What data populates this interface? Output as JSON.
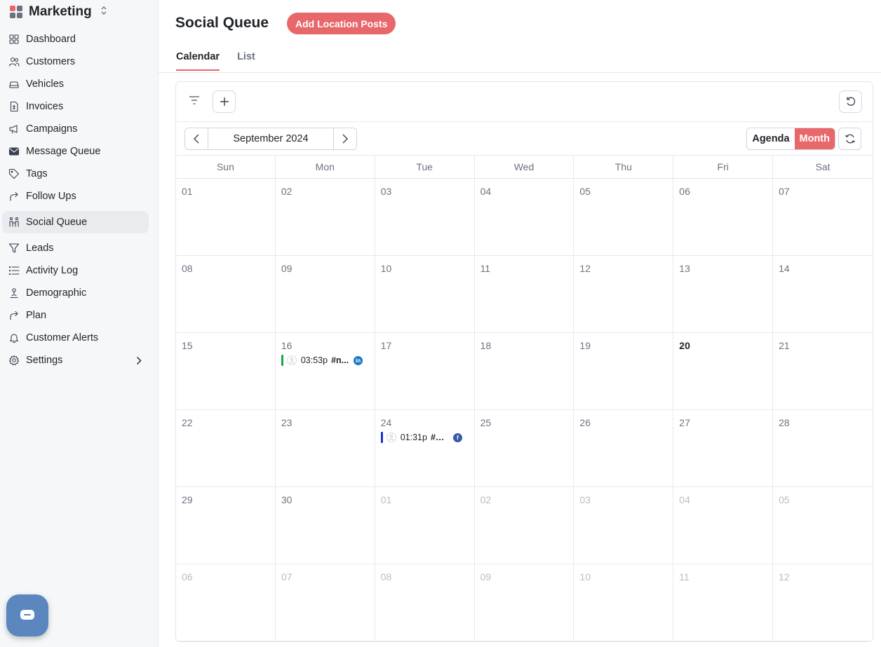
{
  "colors": {
    "accent": "#e8676b",
    "linkedin": "#1a78c2",
    "facebook": "#3b5aa8",
    "event_green": "#1aa548",
    "event_blue": "#1d2ed8",
    "logo": [
      "#e8676b",
      "#6b7280",
      "#6b7280",
      "#6b7280"
    ]
  },
  "brand": {
    "title": "Marketing",
    "switch_icon": "chevron-up-down-icon"
  },
  "sidebar": {
    "items": [
      {
        "label": "Dashboard",
        "icon": "dashboard-icon"
      },
      {
        "label": "Customers",
        "icon": "users-icon"
      },
      {
        "label": "Vehicles",
        "icon": "car-icon"
      },
      {
        "label": "Invoices",
        "icon": "invoice-icon"
      },
      {
        "label": "Campaigns",
        "icon": "megaphone-icon"
      },
      {
        "label": "Message Queue",
        "icon": "envelope-icon"
      },
      {
        "label": "Tags",
        "icon": "tag-icon"
      },
      {
        "label": "Follow Ups",
        "icon": "share-arrow-icon"
      },
      {
        "label": "Social Queue",
        "icon": "people-icon",
        "active": true
      },
      {
        "label": "Leads",
        "icon": "filter-icon"
      },
      {
        "label": "Activity Log",
        "icon": "list-icon"
      },
      {
        "label": "Demographic",
        "icon": "person-pin-icon"
      },
      {
        "label": "Plan",
        "icon": "share-arrow-icon"
      },
      {
        "label": "Customer Alerts",
        "icon": "bell-icon"
      },
      {
        "label": "Settings",
        "icon": "gear-icon",
        "expandable": true
      }
    ]
  },
  "header": {
    "title": "Social Queue",
    "add_button": "Add Location Posts",
    "tabs": [
      {
        "label": "Calendar",
        "active": true
      },
      {
        "label": "List",
        "active": false
      }
    ]
  },
  "calendar": {
    "month_label": "September 2024",
    "views": [
      {
        "label": "Agenda",
        "selected": false
      },
      {
        "label": "Month",
        "selected": true
      }
    ],
    "weekdays": [
      "Sun",
      "Mon",
      "Tue",
      "Wed",
      "Thu",
      "Fri",
      "Sat"
    ],
    "days": [
      {
        "n": "01"
      },
      {
        "n": "02"
      },
      {
        "n": "03"
      },
      {
        "n": "04"
      },
      {
        "n": "05"
      },
      {
        "n": "06"
      },
      {
        "n": "07"
      },
      {
        "n": "08"
      },
      {
        "n": "09"
      },
      {
        "n": "10"
      },
      {
        "n": "11"
      },
      {
        "n": "12"
      },
      {
        "n": "13"
      },
      {
        "n": "14"
      },
      {
        "n": "15"
      },
      {
        "n": "16",
        "events": [
          {
            "time": "03:53p",
            "title": "#n...",
            "network": "linkedin",
            "network_mark": "in",
            "color": "#1aa548"
          }
        ]
      },
      {
        "n": "17"
      },
      {
        "n": "18"
      },
      {
        "n": "19"
      },
      {
        "n": "20",
        "today": true
      },
      {
        "n": "21"
      },
      {
        "n": "22"
      },
      {
        "n": "23"
      },
      {
        "n": "24",
        "events": [
          {
            "time": "01:31p",
            "title": "#oi...",
            "network": "facebook",
            "network_mark": "f",
            "color": "#1d2ed8"
          }
        ]
      },
      {
        "n": "25"
      },
      {
        "n": "26"
      },
      {
        "n": "27"
      },
      {
        "n": "28"
      },
      {
        "n": "29"
      },
      {
        "n": "30"
      },
      {
        "n": "01",
        "other": true
      },
      {
        "n": "02",
        "other": true
      },
      {
        "n": "03",
        "other": true
      },
      {
        "n": "04",
        "other": true
      },
      {
        "n": "05",
        "other": true
      },
      {
        "n": "06",
        "other": true
      },
      {
        "n": "07",
        "other": true
      },
      {
        "n": "08",
        "other": true
      },
      {
        "n": "09",
        "other": true
      },
      {
        "n": "10",
        "other": true
      },
      {
        "n": "11",
        "other": true
      },
      {
        "n": "12",
        "other": true
      }
    ]
  }
}
